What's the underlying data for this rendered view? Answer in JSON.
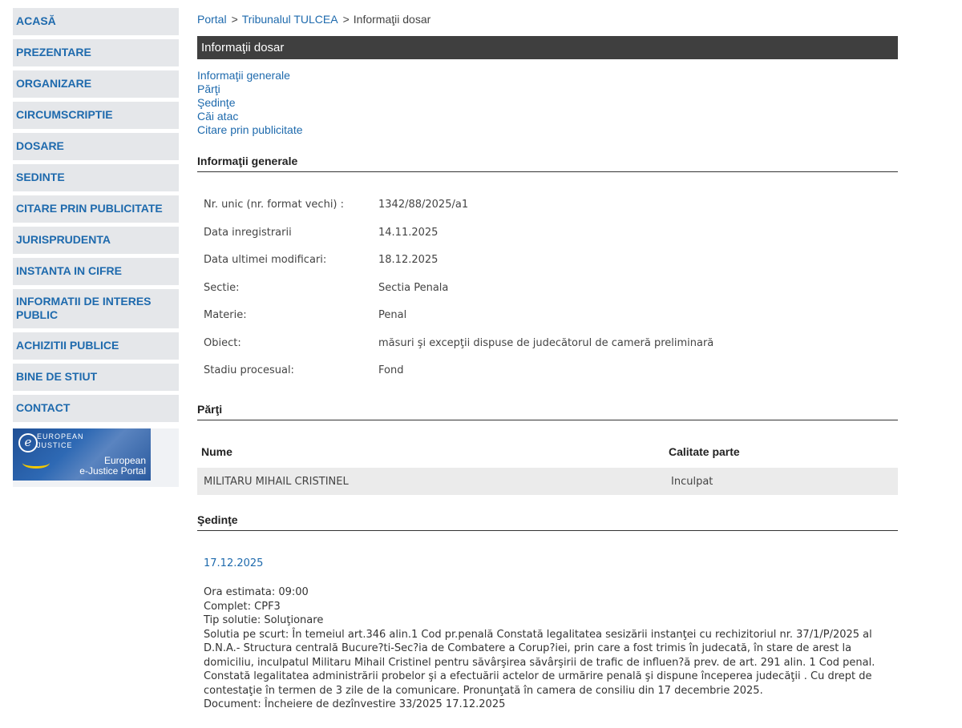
{
  "sidebar": {
    "items": [
      {
        "label": "ACASĂ"
      },
      {
        "label": "PREZENTARE"
      },
      {
        "label": "ORGANIZARE"
      },
      {
        "label": "CIRCUMSCRIPTIE"
      },
      {
        "label": "DOSARE"
      },
      {
        "label": "SEDINTE"
      },
      {
        "label": "CITARE PRIN PUBLICITATE"
      },
      {
        "label": "JURISPRUDENTA"
      },
      {
        "label": "INSTANTA IN CIFRE"
      },
      {
        "label": "INFORMATII DE INTERES PUBLIC"
      },
      {
        "label": "ACHIZITII PUBLICE"
      },
      {
        "label": "BINE DE STIUT"
      },
      {
        "label": "CONTACT"
      }
    ],
    "ejustice": {
      "line1": "EUROPEAN",
      "line2": "JUSTICE",
      "line3": "European",
      "line4": "e-Justice Portal",
      "logo_letter": "e"
    }
  },
  "breadcrumb": {
    "portal": "Portal",
    "court": "Tribunalul TULCEA",
    "current": "Informaţii dosar",
    "separator": ">"
  },
  "page_title": "Informaţii dosar",
  "anchors": [
    "Informaţii generale",
    "Părţi",
    "Şedinţe",
    "Căi atac",
    "Citare prin publicitate"
  ],
  "general": {
    "heading": "Informaţii generale",
    "rows": [
      {
        "label": "Nr. unic (nr. format vechi) :",
        "value": "1342/88/2025/a1"
      },
      {
        "label": "Data inregistrarii",
        "value": "14.11.2025"
      },
      {
        "label": "Data ultimei modificari:",
        "value": "18.12.2025"
      },
      {
        "label": "Sectie:",
        "value": "Sectia Penala"
      },
      {
        "label": "Materie:",
        "value": "Penal"
      },
      {
        "label": "Obiect:",
        "value": "măsuri şi excepţii dispuse de judecătorul de cameră preliminară"
      },
      {
        "label": "Stadiu procesual:",
        "value": "Fond"
      }
    ]
  },
  "parti": {
    "heading": "Părţi",
    "col_name": "Nume",
    "col_role": "Calitate parte",
    "rows": [
      {
        "name": "MILITARU MIHAIL CRISTINEL",
        "role": "Inculpat"
      }
    ]
  },
  "sedinte": {
    "heading": "Şedinţe",
    "date": "17.12.2025",
    "ora": "Ora estimata: 09:00",
    "complet": "Complet: CPF3",
    "tip": "Tip solutie: Soluţionare",
    "solutie": "Solutia pe scurt: În temeiul art.346 alin.1 Cod pr.penală Constată legalitatea sesizării instanţei cu rechizitoriul nr. 37/1/P/2025 al D.N.A.- Structura centrală Bucure?ti-Sec?ia de Combatere a Corup?iei, prin care a fost trimis în judecată, în stare de arest la domiciliu, inculpatul Militaru Mihail Cristinel pentru săvârşirea săvârşirii de trafic de influen?ă prev. de art. 291 alin. 1 Cod penal. Constată legalitatea administrării probelor şi a efectuării actelor de urmărire penală şi dispune începerea judecăţii . Cu drept de contestaţie în termen de 3 zile de la comunicare. Pronunţată în camera de consiliu din 17 decembrie 2025.",
    "document": "Document: Încheiere de dezînvestire  33/2025  17.12.2025"
  }
}
